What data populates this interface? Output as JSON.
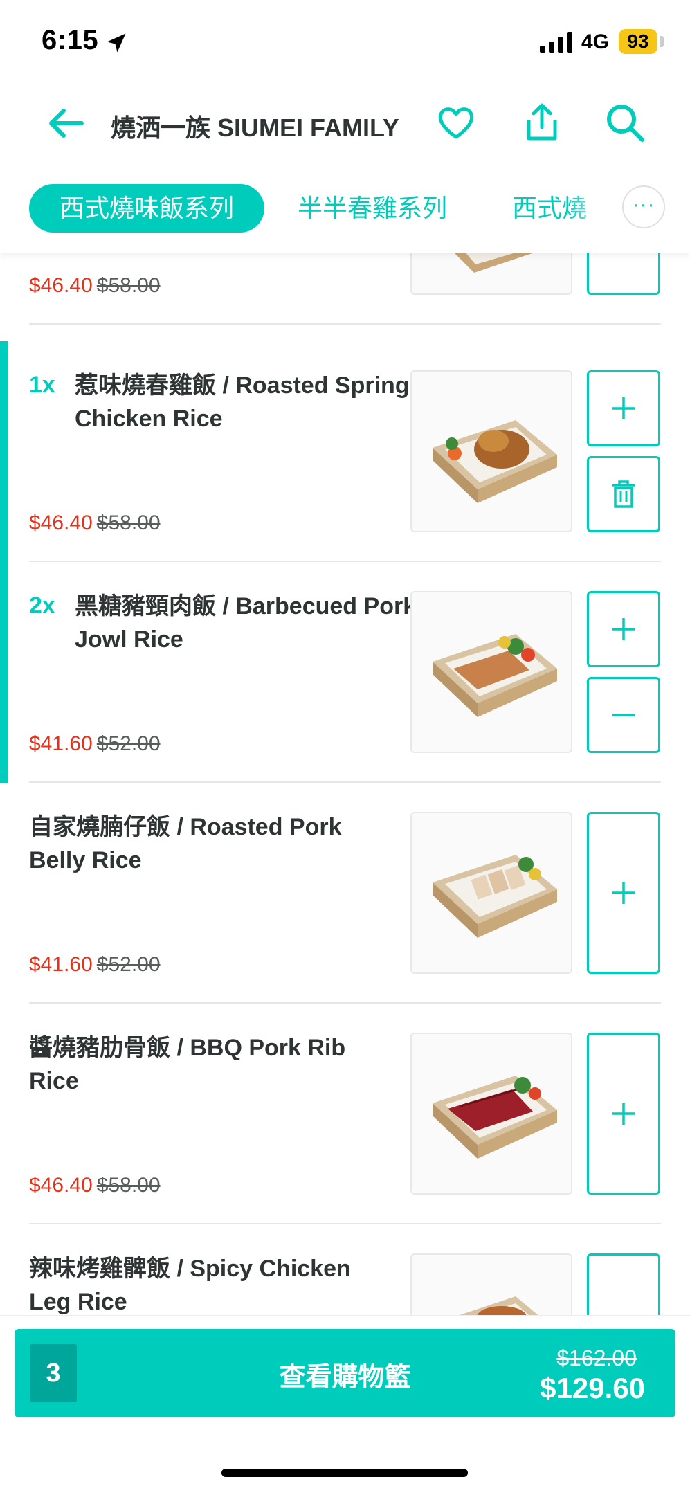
{
  "status_bar": {
    "time": "6:15",
    "network": "4G",
    "battery": "93"
  },
  "header": {
    "title": "燒洒一族 SIUMEI FAMILY"
  },
  "tabs": [
    {
      "label": "西式燒味飯系列",
      "active": true
    },
    {
      "label": "半半春雞系列",
      "active": false
    },
    {
      "label": "西式燒",
      "active": false
    }
  ],
  "tabs_more_label": "···",
  "items": [
    {
      "qty": "",
      "name": "",
      "price": "$46.40",
      "original_price": "$58.00",
      "selected": false,
      "buttons": [
        "add"
      ]
    },
    {
      "qty": "1x",
      "name": "惹味燒春雞飯 / Roasted Spring Chicken Rice",
      "price": "$46.40",
      "original_price": "$58.00",
      "selected": true,
      "buttons": [
        "add",
        "delete"
      ]
    },
    {
      "qty": "2x",
      "name": "黑糖豬頸肉飯 / Barbecued Pork Jowl Rice",
      "price": "$41.60",
      "original_price": "$52.00",
      "selected": true,
      "buttons": [
        "add",
        "remove"
      ]
    },
    {
      "qty": "",
      "name": "自家燒腩仔飯 / Roasted Pork Belly Rice",
      "price": "$41.60",
      "original_price": "$52.00",
      "selected": false,
      "buttons": [
        "add"
      ]
    },
    {
      "qty": "",
      "name": "醬燒豬肋骨飯 / BBQ Pork Rib Rice",
      "price": "$46.40",
      "original_price": "$58.00",
      "selected": false,
      "buttons": [
        "add"
      ]
    },
    {
      "qty": "",
      "name": "辣味烤雞髀飯 / Spicy Chicken Leg Rice",
      "price": "",
      "original_price": "",
      "selected": false,
      "buttons": [
        "add"
      ]
    }
  ],
  "cart": {
    "count": "3",
    "label": "查看購物籃",
    "original_total": "$162.00",
    "total": "$129.60"
  },
  "colors": {
    "accent": "#00ccbc",
    "price_red": "#e2341d",
    "text": "#2e3333"
  }
}
